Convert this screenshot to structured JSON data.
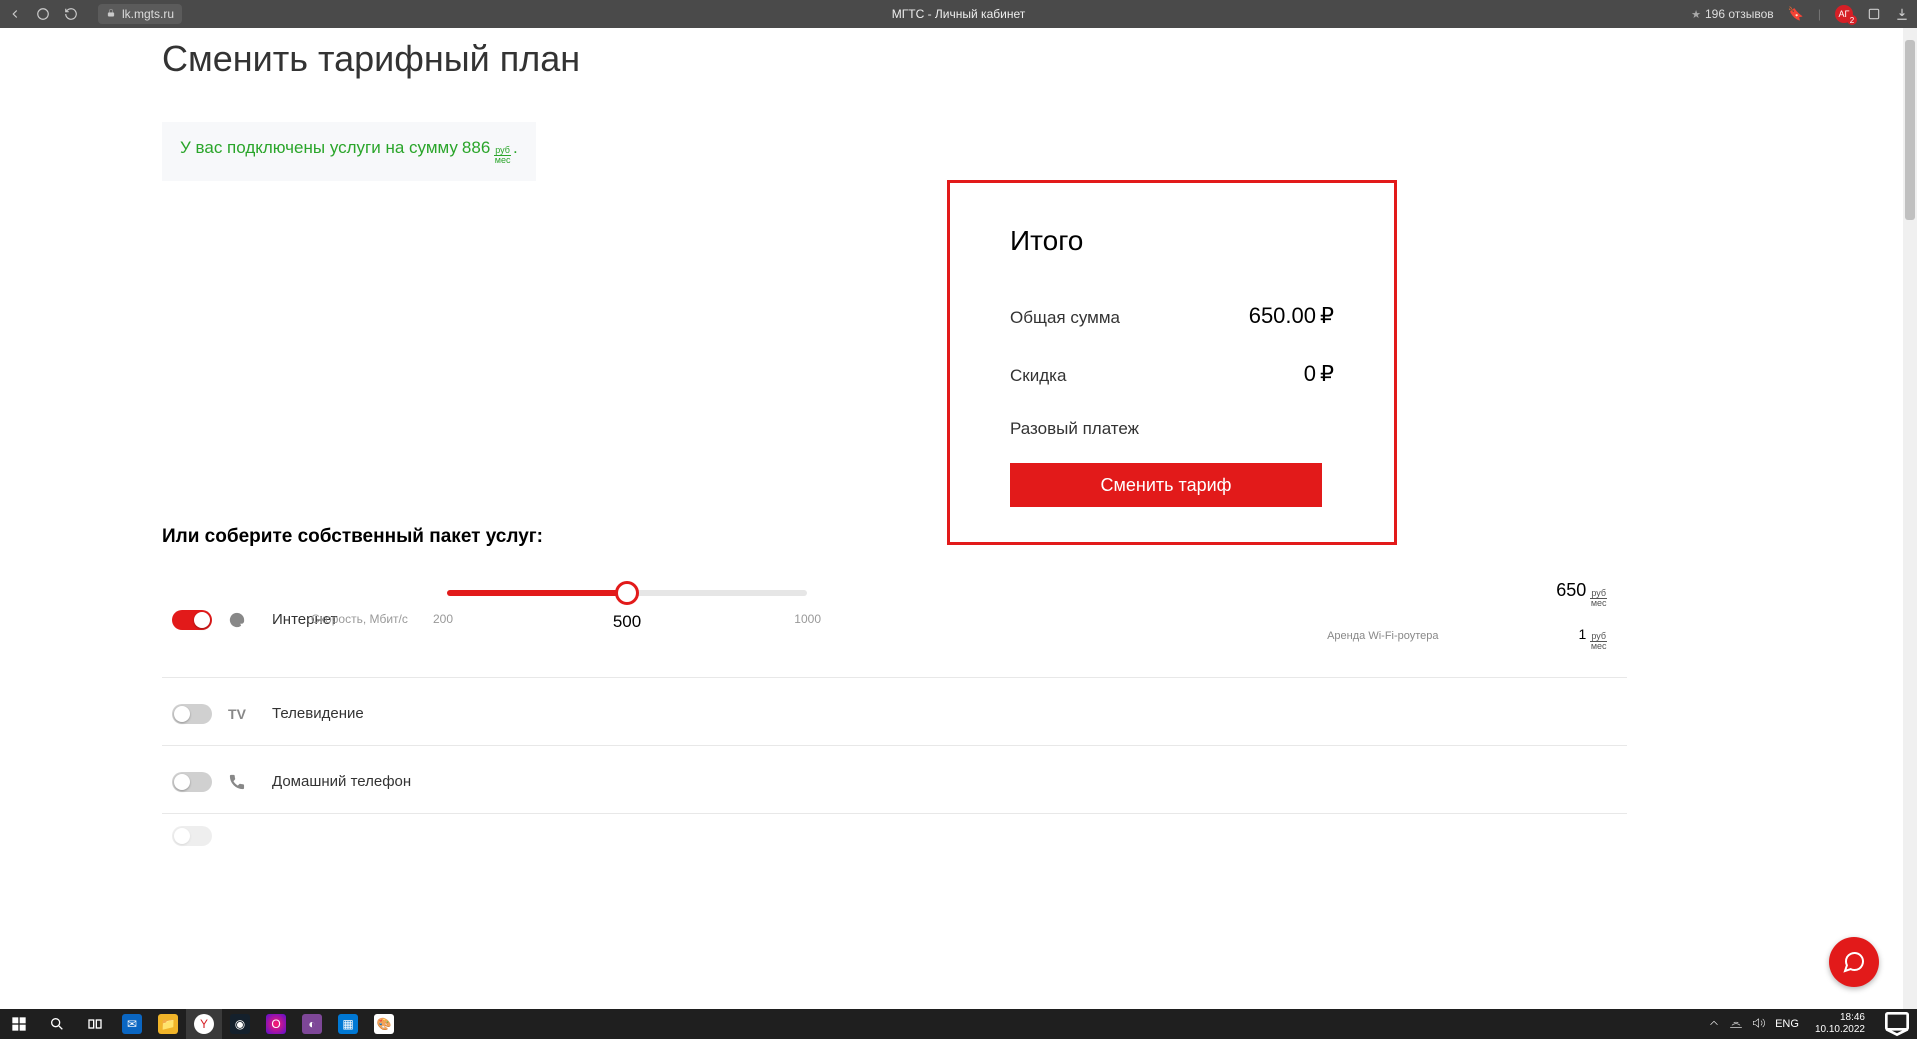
{
  "chrome": {
    "url": "lk.mgts.ru",
    "title": "МГТС - Личный кабинет",
    "reviews": "196 отзывов",
    "avatar_initials": "АГ",
    "avatar_badge": "2"
  },
  "page": {
    "title": "Сменить тарифный план",
    "notice_prefix": "У вас подключены услуги на сумму",
    "notice_amount": "886",
    "notice_unit_top": "руб",
    "notice_unit_bot": "мес",
    "notice_suffix": "."
  },
  "summary": {
    "title": "Итого",
    "total_label": "Общая сумма",
    "total_value": "650.00",
    "currency": "₽",
    "discount_label": "Скидка",
    "discount_value": "0",
    "onetime_label": "Разовый платеж",
    "button": "Сменить тариф"
  },
  "custom": {
    "heading": "Или соберите собственный пакет услуг:",
    "internet_label": "Интернет",
    "speed_label": "Скорость, Мбит/с",
    "tick_low": "200",
    "tick_mid": "500",
    "tick_high": "1000",
    "internet_price": "650",
    "unit_top": "руб",
    "unit_bot": "мес",
    "router_label": "Аренда Wi-Fi-роутера",
    "router_price": "1",
    "tv_label": "Телевидение",
    "phone_label": "Домашний телефон"
  },
  "taskbar": {
    "lang": "ENG",
    "time": "18:46",
    "date": "10.10.2022"
  }
}
